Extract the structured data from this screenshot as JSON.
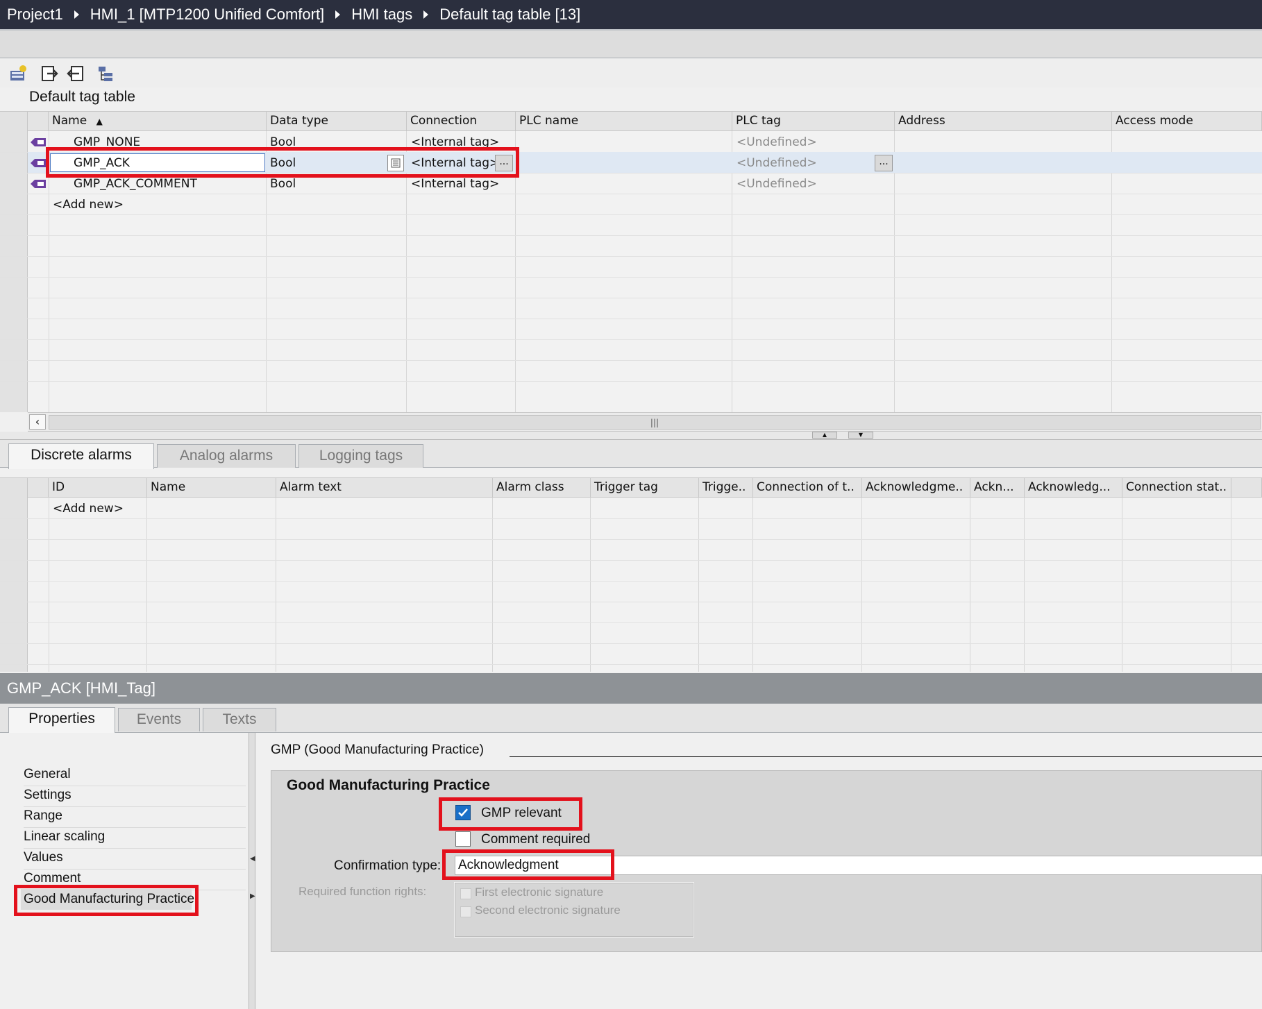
{
  "breadcrumb": [
    "Project1",
    "HMI_1 [MTP1200 Unified Comfort]",
    "HMI tags",
    "Default tag table [13]"
  ],
  "tag_table": {
    "title": "Default tag table",
    "columns": [
      "Name",
      "Data type",
      "Connection",
      "PLC name",
      "PLC tag",
      "Address",
      "Access mode"
    ],
    "rows": [
      {
        "name": "GMP_NONE",
        "data_type": "Bool",
        "connection": "<Internal tag>",
        "plc_tag": "<Undefined>"
      },
      {
        "name": "GMP_ACK",
        "data_type": "Bool",
        "connection": "<Internal tag>",
        "plc_tag": "<Undefined>"
      },
      {
        "name": "GMP_ACK_COMMENT",
        "data_type": "Bool",
        "connection": "<Internal tag>",
        "plc_tag": "<Undefined>"
      }
    ],
    "add_new": "<Add new>",
    "browse_label": "..."
  },
  "alarm_tabs": [
    "Discrete alarms",
    "Analog alarms",
    "Logging tags"
  ],
  "alarm_table": {
    "columns": [
      "ID",
      "Name",
      "Alarm text",
      "Alarm class",
      "Trigger tag",
      "Trigge..",
      "Connection of t..",
      "Acknowledgme..",
      "Ackn...",
      "Acknowledg...",
      "Connection stat.."
    ],
    "add_new": "<Add new>"
  },
  "inspector": {
    "title": "GMP_ACK [HMI_Tag]",
    "tabs": [
      "Properties",
      "Events",
      "Texts"
    ],
    "nav_items": [
      "General",
      "Settings",
      "Range",
      "Linear scaling",
      "Values",
      "Comment",
      "Good Manufacturing Practice"
    ],
    "section_title": "GMP (Good Manufacturing Practice)",
    "panel_title": "Good Manufacturing Practice",
    "gmp_relevant_label": "GMP relevant",
    "gmp_relevant_checked": true,
    "comment_required_label": "Comment required",
    "comment_required_checked": false,
    "confirmation_type_label": "Confirmation type:",
    "confirmation_type_value": "Acknowledgment",
    "required_rights_label": "Required function rights:",
    "first_sig_label": "First electronic signature",
    "second_sig_label": "Second electronic signature"
  },
  "colors": {
    "highlight": "#e3111c",
    "title_bar": "#2b2f3e",
    "inspector_bar": "#8e9296",
    "checkbox": "#1a6fc7"
  }
}
